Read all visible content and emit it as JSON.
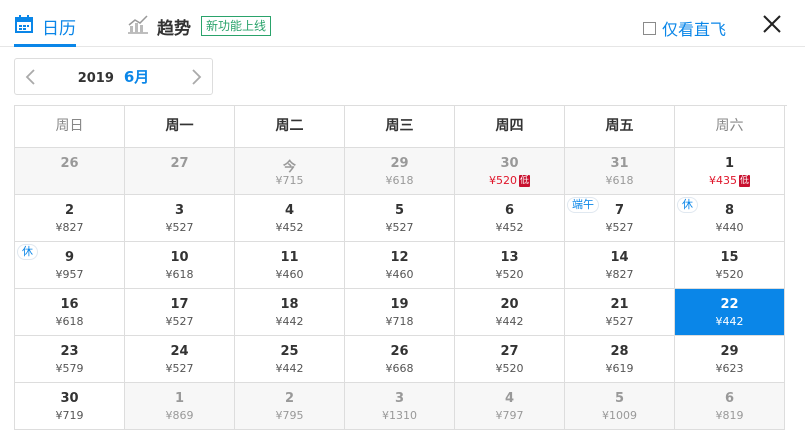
{
  "tabs": {
    "calendar_label": "日历",
    "trend_label": "趋势",
    "new_badge": "新功能上线"
  },
  "filter": {
    "direct_label": "仅看直飞",
    "checked": false
  },
  "month_selector": {
    "year": "2019",
    "month": "6月"
  },
  "weekdays": [
    "周日",
    "周一",
    "周二",
    "周三",
    "周四",
    "周五",
    "周六"
  ],
  "rows": [
    [
      {
        "day": "26",
        "price": "",
        "dim": true
      },
      {
        "day": "27",
        "price": "",
        "dim": true
      },
      {
        "day": "今",
        "price": "¥715",
        "dim": true
      },
      {
        "day": "29",
        "price": "¥618",
        "dim": true
      },
      {
        "day": "30",
        "price": "¥520",
        "dim": true,
        "low": true
      },
      {
        "day": "31",
        "price": "¥618",
        "dim": true
      },
      {
        "day": "1",
        "price": "¥435",
        "low": true
      }
    ],
    [
      {
        "day": "2",
        "price": "¥827"
      },
      {
        "day": "3",
        "price": "¥527"
      },
      {
        "day": "4",
        "price": "¥452"
      },
      {
        "day": "5",
        "price": "¥527"
      },
      {
        "day": "6",
        "price": "¥452"
      },
      {
        "day": "7",
        "price": "¥527",
        "tag": "端午"
      },
      {
        "day": "8",
        "price": "¥440",
        "tag": "休"
      }
    ],
    [
      {
        "day": "9",
        "price": "¥957",
        "tag": "休"
      },
      {
        "day": "10",
        "price": "¥618"
      },
      {
        "day": "11",
        "price": "¥460"
      },
      {
        "day": "12",
        "price": "¥460"
      },
      {
        "day": "13",
        "price": "¥520"
      },
      {
        "day": "14",
        "price": "¥827"
      },
      {
        "day": "15",
        "price": "¥520"
      }
    ],
    [
      {
        "day": "16",
        "price": "¥618"
      },
      {
        "day": "17",
        "price": "¥527"
      },
      {
        "day": "18",
        "price": "¥442"
      },
      {
        "day": "19",
        "price": "¥718"
      },
      {
        "day": "20",
        "price": "¥442"
      },
      {
        "day": "21",
        "price": "¥527"
      },
      {
        "day": "22",
        "price": "¥442",
        "selected": true
      }
    ],
    [
      {
        "day": "23",
        "price": "¥579"
      },
      {
        "day": "24",
        "price": "¥527"
      },
      {
        "day": "25",
        "price": "¥442"
      },
      {
        "day": "26",
        "price": "¥668"
      },
      {
        "day": "27",
        "price": "¥520"
      },
      {
        "day": "28",
        "price": "¥619"
      },
      {
        "day": "29",
        "price": "¥623"
      }
    ],
    [
      {
        "day": "30",
        "price": "¥719"
      },
      {
        "day": "1",
        "price": "¥869",
        "dim": true
      },
      {
        "day": "2",
        "price": "¥795",
        "dim": true
      },
      {
        "day": "3",
        "price": "¥1310",
        "dim": true
      },
      {
        "day": "4",
        "price": "¥797",
        "dim": true
      },
      {
        "day": "5",
        "price": "¥1009",
        "dim": true
      },
      {
        "day": "6",
        "price": "¥819",
        "dim": true
      }
    ]
  ],
  "low_label": "低",
  "colors": {
    "accent": "#0a86e8",
    "low_price": "#e0162b",
    "new_badge": "#2aa36b"
  }
}
